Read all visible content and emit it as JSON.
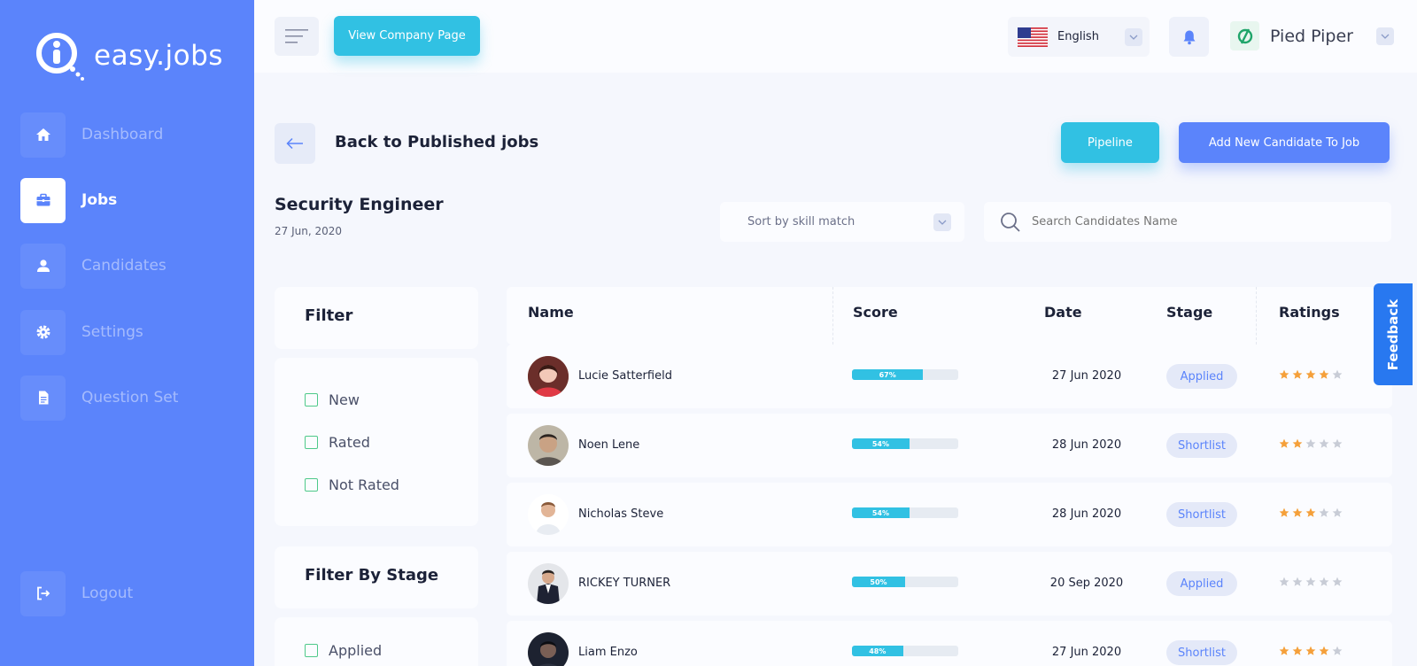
{
  "brand": {
    "name": "easy.jobs"
  },
  "sidebar": {
    "items": [
      {
        "label": "Dashboard",
        "icon": "home-icon",
        "active": false
      },
      {
        "label": "Jobs",
        "icon": "briefcase-icon",
        "active": true
      },
      {
        "label": "Candidates",
        "icon": "user-icon",
        "active": false
      },
      {
        "label": "Settings",
        "icon": "gear-icon",
        "active": false
      },
      {
        "label": "Question Set",
        "icon": "document-icon",
        "active": false
      }
    ],
    "logout_label": "Logout"
  },
  "topbar": {
    "view_company_label": "View Company Page",
    "language": "English",
    "company_name": "Pied Piper"
  },
  "page": {
    "back_label": "Back to Published jobs",
    "pipeline_label": "Pipeline",
    "add_candidate_label": "Add New Candidate To Job",
    "job_title": "Security Engineer",
    "job_date": "27 Jun, 2020",
    "sort_selected": "Sort by skill match",
    "search_placeholder": "Search Candidates Name"
  },
  "filter": {
    "title": "Filter",
    "options": [
      "New",
      "Rated",
      "Not Rated"
    ],
    "stage_title": "Filter By Stage",
    "stage_options": [
      "Applied"
    ]
  },
  "table": {
    "headers": {
      "name": "Name",
      "score": "Score",
      "date": "Date",
      "stage": "Stage",
      "ratings": "Ratings"
    },
    "rows": [
      {
        "name": "Lucie Satterfield",
        "score": 67,
        "score_label": "67%",
        "date": "27 Jun 2020",
        "stage": "Applied",
        "rating": 4
      },
      {
        "name": "Noen Lene",
        "score": 54,
        "score_label": "54%",
        "date": "28 Jun 2020",
        "stage": "Shortlist",
        "rating": 2
      },
      {
        "name": "Nicholas Steve",
        "score": 54,
        "score_label": "54%",
        "date": "28 Jun 2020",
        "stage": "Shortlist",
        "rating": 3
      },
      {
        "name": "RICKEY TURNER",
        "score": 50,
        "score_label": "50%",
        "date": "20 Sep 2020",
        "stage": "Applied",
        "rating": 0
      },
      {
        "name": "Liam Enzo",
        "score": 48,
        "score_label": "48%",
        "date": "27 Jun 2020",
        "stage": "Shortlist",
        "rating": 4
      }
    ]
  },
  "feedback_label": "Feedback",
  "colors": {
    "primary": "#5b84fb",
    "accent": "#31c1e3",
    "star": "#f5a03a",
    "star_empty": "#c8ccd6"
  }
}
